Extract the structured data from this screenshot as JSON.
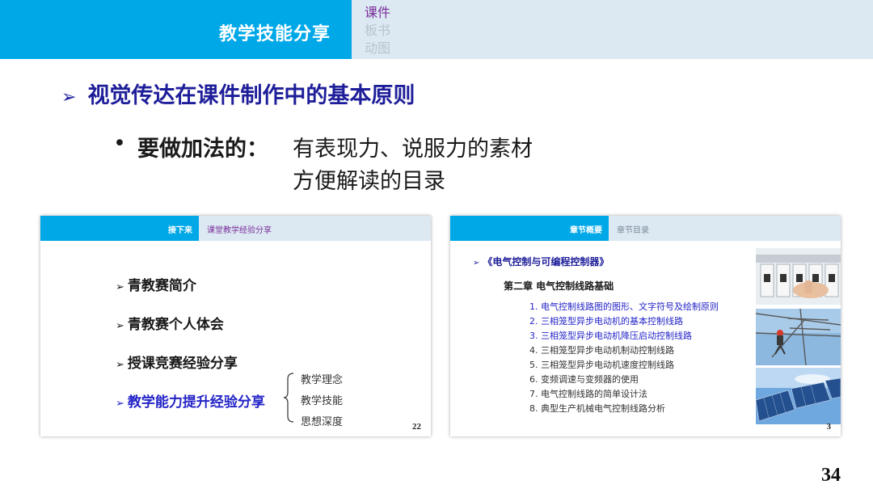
{
  "header": {
    "title": "教学技能分享",
    "nav": [
      "课件",
      "板书",
      "动图"
    ]
  },
  "main": {
    "heading_arrow": "➢",
    "heading": "视觉传达在课件制作中的基本原则",
    "bullet": "•",
    "bullet_label": "要做加法的：",
    "bullet_line1": "有表现力、说服力的素材",
    "bullet_line2": "方便解读的目录"
  },
  "thumb_a": {
    "header_title": "接下来",
    "header_sub": "课堂教学经验分享",
    "arrow": "➢",
    "items": [
      "青教赛简介",
      "青教赛个人体会",
      "授课竞赛经验分享",
      "教学能力提升经验分享"
    ],
    "sub_items": [
      "教学理念",
      "教学技能",
      "思想深度"
    ],
    "page": "22"
  },
  "thumb_b": {
    "header_title": "章节概要",
    "header_sub": "章节目录",
    "arrow": "➢",
    "book": "《电气控制与可编程控制器》",
    "chapter": "第二章  电气控制线路基础",
    "items": [
      "1. 电气控制线路图的图形、文字符号及绘制原则",
      "2. 三相笼型异步电动机的基本控制线路",
      "3. 三相笼型异步电动机降压启动控制线路",
      "4. 三相笼型异步电动机制动控制线路",
      "5. 三相笼型异步电动机速度控制线路",
      "6. 变频调速与变频器的使用",
      "7. 电气控制线路的简单设计法",
      "8. 典型生产机械电气控制线路分析"
    ],
    "page": "3"
  },
  "slide_number": "34",
  "colors": {
    "accent_blue": "#00a8e8",
    "header_light": "#dce8f2",
    "heading_navy": "#1e1e9a",
    "nav_purple": "#7a2f9a",
    "highlight_blue": "#2424c8"
  }
}
